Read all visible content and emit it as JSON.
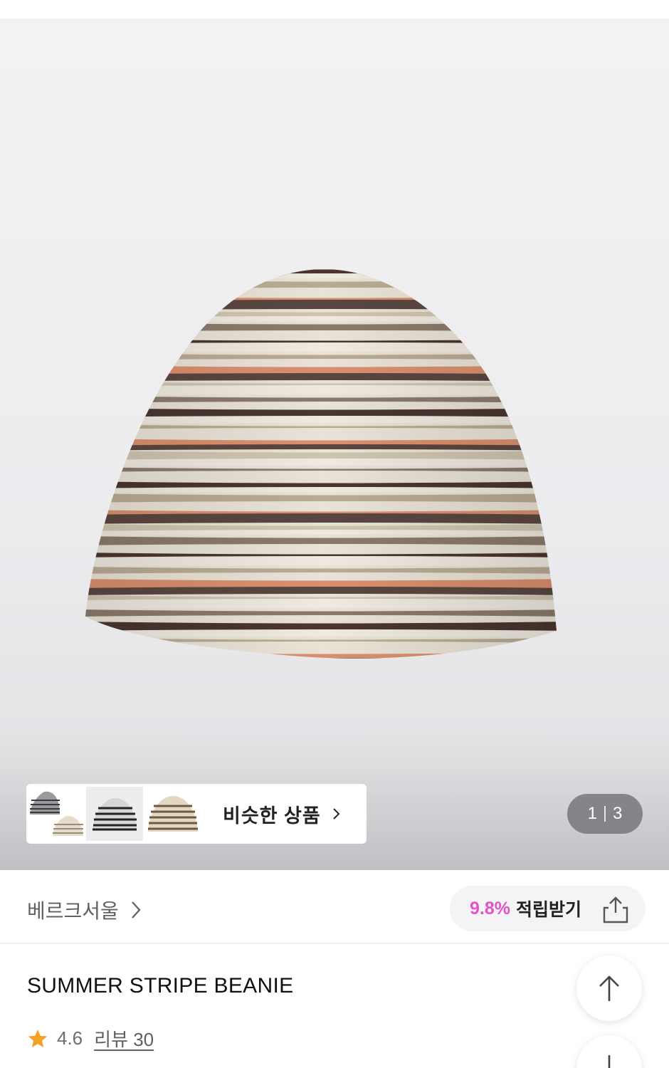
{
  "gallery": {
    "similar_label": "비슷한 상품",
    "thumbnails": [
      "striped-beanie-thumb-1",
      "striped-beanie-thumb-2",
      "striped-beanie-thumb-3"
    ],
    "page_current": "1",
    "page_total": "3"
  },
  "brand": {
    "name": "베르크서울"
  },
  "points": {
    "rate": "9.8%",
    "label": "적립받기"
  },
  "product": {
    "title": "SUMMER STRIPE BEANIE",
    "rating": "4.6",
    "review_label": "리뷰 30"
  },
  "colors": {
    "accent_pink": "#e253c6",
    "star": "#f4a126"
  },
  "icons": [
    "chevron-right-icon",
    "share-icon",
    "star-icon",
    "arrow-up-icon",
    "arrow-down-icon"
  ]
}
